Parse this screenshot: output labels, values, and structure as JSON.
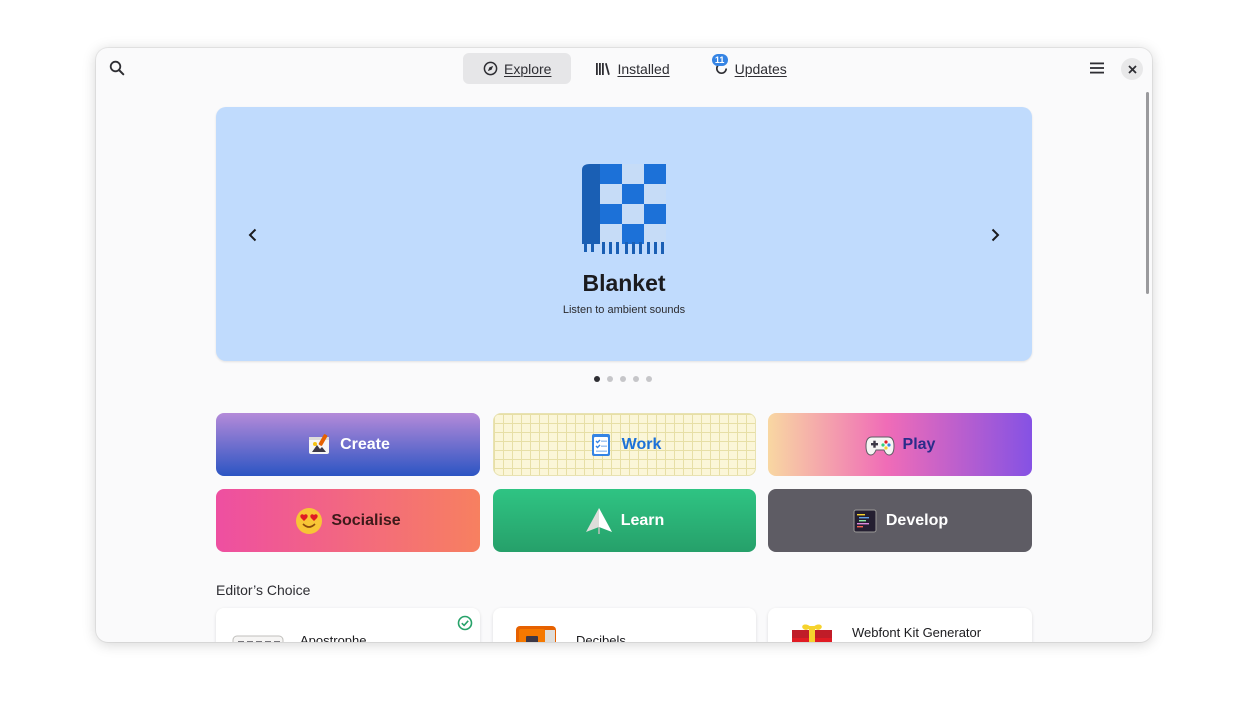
{
  "header": {
    "tabs": [
      {
        "label": "Explore",
        "active": true,
        "icon": "compass-icon"
      },
      {
        "label": "Installed",
        "active": false,
        "icon": "library-icon"
      },
      {
        "label": "Updates",
        "active": false,
        "icon": "refresh-icon",
        "badge": "11"
      }
    ],
    "search_icon": "search-icon",
    "menu_icon": "hamburger-menu-icon",
    "close_icon": "close-icon"
  },
  "featured": {
    "name": "Blanket",
    "summary": "Listen to ambient sounds",
    "background": "#c0dbfd",
    "dots_total": 5,
    "dots_active_index": 0
  },
  "categories": [
    {
      "label": "Create",
      "icon": "create-icon"
    },
    {
      "label": "Work",
      "icon": "work-icon"
    },
    {
      "label": "Play",
      "icon": "gamepad-icon"
    },
    {
      "label": "Socialise",
      "icon": "heart-eyes-emoji-icon"
    },
    {
      "label": "Learn",
      "icon": "paper-plane-icon"
    },
    {
      "label": "Develop",
      "icon": "terminal-icon"
    }
  ],
  "editors_choice": {
    "title": "Editor’s Choice",
    "apps": [
      {
        "name": "Apostrophe",
        "installed": true
      },
      {
        "name": "Decibels",
        "installed": false
      },
      {
        "name": "Webfont Kit Generator",
        "installed": false
      }
    ]
  },
  "colors": {
    "accent": "#3584e4",
    "installed_check": "#26a269"
  }
}
